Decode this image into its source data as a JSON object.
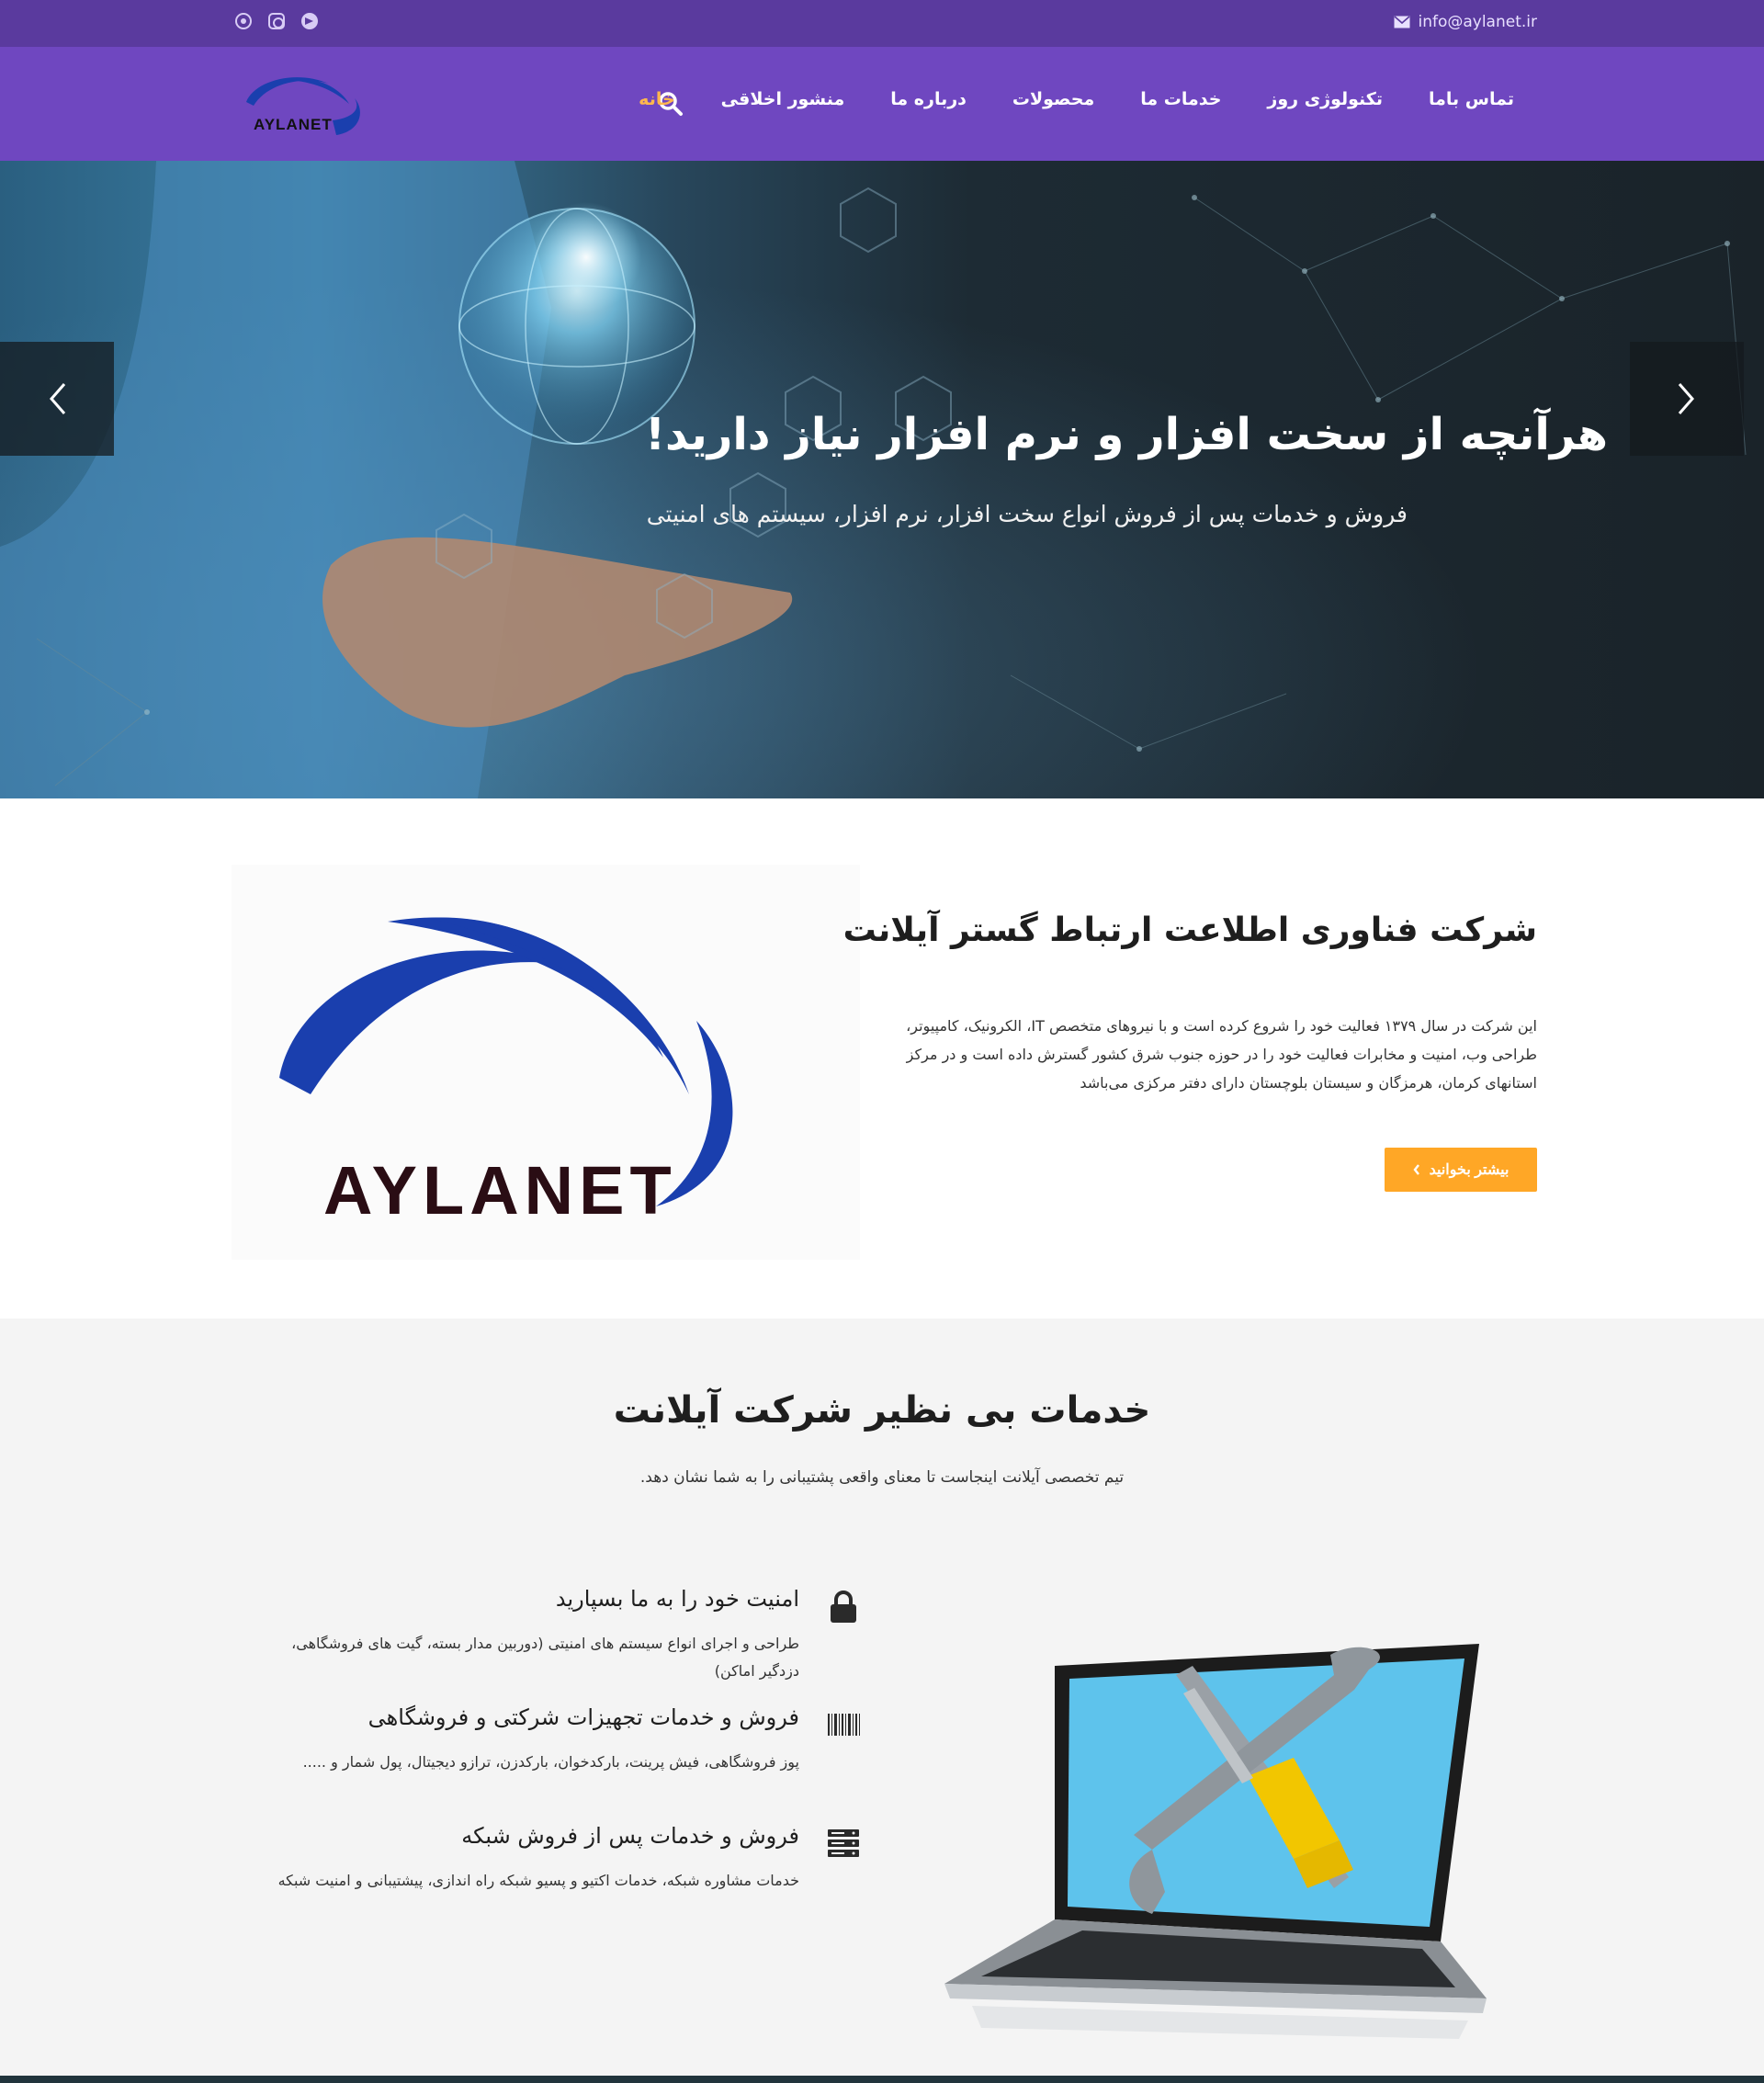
{
  "topbar": {
    "email": "info@aylanet.ir",
    "socials": [
      "whatsapp-icon",
      "instagram-icon",
      "telegram-icon"
    ]
  },
  "nav": {
    "logo_text": "AYLANET",
    "items": [
      "خانه",
      "منشور اخلاقی",
      "درباره ما",
      "محصولات",
      "خدمات ما",
      "تکنولوژی روز",
      "تماس باما"
    ],
    "active_index": 0
  },
  "hero": {
    "title": "هرآنچه از سخت افزار و نرم افزار نیاز دارید!",
    "subtitle": "فروش و خدمات پس از فروش انواع سخت افزار، نرم افزار، سیستم های امنیتی"
  },
  "about": {
    "title": "شرکت فناوری اطلاعت ارتباط گستر آیلانت",
    "text": "این شرکت در سال ۱۳۷۹ فعالیت خود را شروع کرده است و با نیروهای متخصص IT، الکرونیک، کامپیوتر، طراحی وب، امنیت و مخابرات فعالیت خود را در حوزه جنوب شرق کشور گسترش داده است و در مرکز استانهای کرمان، هرمزگان و سیستان بلوچستان دارای دفتر مرکزی می‌باشد",
    "button": "بیشتر بخوانید",
    "logo_text": "AYLANET"
  },
  "services": {
    "title": "خدمات بی نظیر شرکت آیلانت",
    "subtitle": "تیم تخصصی آیلانت اینجاست تا معنای واقعی پشتیبانی را به شما نشان دهد.",
    "items": [
      {
        "title": "امنیت خود را به ما بسپارید",
        "description": "طراحی و اجرای انواع سیستم های امنیتی (دوربین مدار بسته، گیت های فروشگاهی، دزدگیر اماکن)",
        "icon": "lock-icon"
      },
      {
        "title": "فروش و خدمات تجهیزات شرکتی و فروشگاهی",
        "description": "پوز فروشگاهی، فیش پرینت، بارکدخوان، بارکدزن، ترازو دیجیتال، پول شمار و .....",
        "icon": "barcode-icon"
      },
      {
        "title": "فروش و خدمات پس از فروش شبکه",
        "description": "خدمات مشاوره شبکه، خدمات اکتیو و پسیو شبکه راه اندازی، پیشتیبانی و امنیت شبکه",
        "icon": "server-icon"
      }
    ]
  },
  "colors": {
    "topbar": "#5a3a9e",
    "navbar": "#6f47c0",
    "accent": "#ffa726",
    "active_menu": "#ffb74d"
  }
}
